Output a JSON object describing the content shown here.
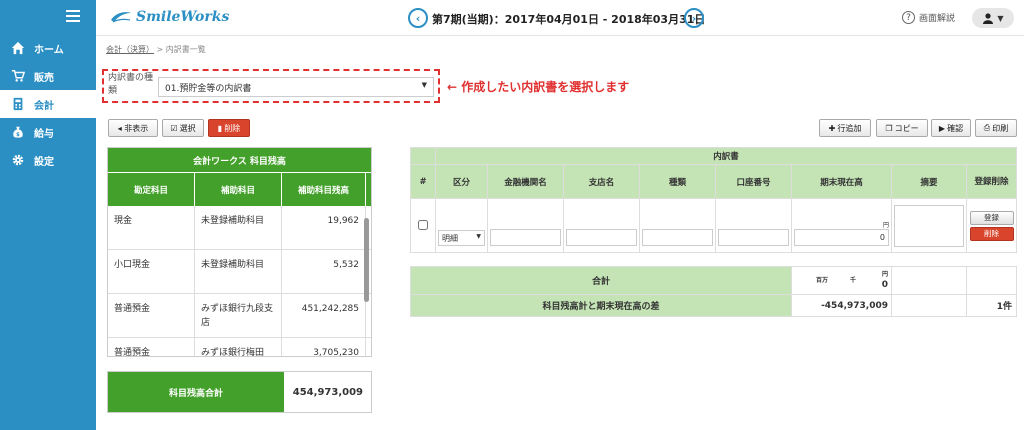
{
  "brand": {
    "name": "SmileWorks"
  },
  "sidebar": {
    "items": [
      {
        "label": "ホーム",
        "icon": "home-icon",
        "active": false
      },
      {
        "label": "販売",
        "icon": "cart-icon",
        "active": false
      },
      {
        "label": "会計",
        "icon": "calculator-icon",
        "active": true
      },
      {
        "label": "給与",
        "icon": "money-bag-icon",
        "active": false
      },
      {
        "label": "設定",
        "icon": "gear-icon",
        "active": false
      }
    ]
  },
  "header": {
    "period": "第7期(当期)：2017年04月01日 - 2018年03月31日",
    "help_label": "画面解説"
  },
  "breadcrumb": {
    "parent": "会計（決算）",
    "separator": ">",
    "current": "内訳書一覧"
  },
  "selector": {
    "label": "内訳書の種類",
    "value": "01.預貯金等の内訳書",
    "annotation": "← 作成したい内訳書を選択します"
  },
  "toolbar_left": {
    "hide_label": "◂ 非表示",
    "select_label": "選択",
    "delete_label": "削除"
  },
  "toolbar_right": {
    "add_row_label": "行追加",
    "copy_label": "コピー",
    "confirm_label": "確認",
    "print_label": "印刷"
  },
  "balance": {
    "title": "会計ワークス 科目残高",
    "headers": [
      "勘定科目",
      "補助科目",
      "補助科目残高"
    ],
    "rows": [
      {
        "account": "現金",
        "sub": "未登録補助科目",
        "amount": "19,962"
      },
      {
        "account": "小口現金",
        "sub": "未登録補助科目",
        "amount": "5,532"
      },
      {
        "account": "普通預金",
        "sub": "みずほ銀行九段支店",
        "amount": "451,242,285"
      },
      {
        "account": "普通預金",
        "sub": "みずほ銀行梅田",
        "amount": "3,705,230"
      }
    ],
    "total_label": "科目残高合計",
    "total_value": "454,973,009"
  },
  "detail": {
    "title": "内訳書",
    "headers": [
      "#",
      "区分",
      "金融機関名",
      "支店名",
      "種類",
      "口座番号",
      "期末現在高",
      "摘要",
      "登録削除"
    ],
    "row": {
      "kubun": "明細",
      "unit": "円",
      "amount": "0",
      "register_label": "登録",
      "delete_label": "削除"
    }
  },
  "summary": {
    "total_label": "合計",
    "units": [
      "百万",
      "千",
      "円"
    ],
    "total_value": "0",
    "diff_label": "科目残高計と期末現在高の差",
    "diff_value": "-454,973,009",
    "count": "1件"
  },
  "colors": {
    "sidebar": "#2b8fc4",
    "green": "#43a02a",
    "light_green": "#c5e4b6",
    "red": "#d9442c"
  }
}
